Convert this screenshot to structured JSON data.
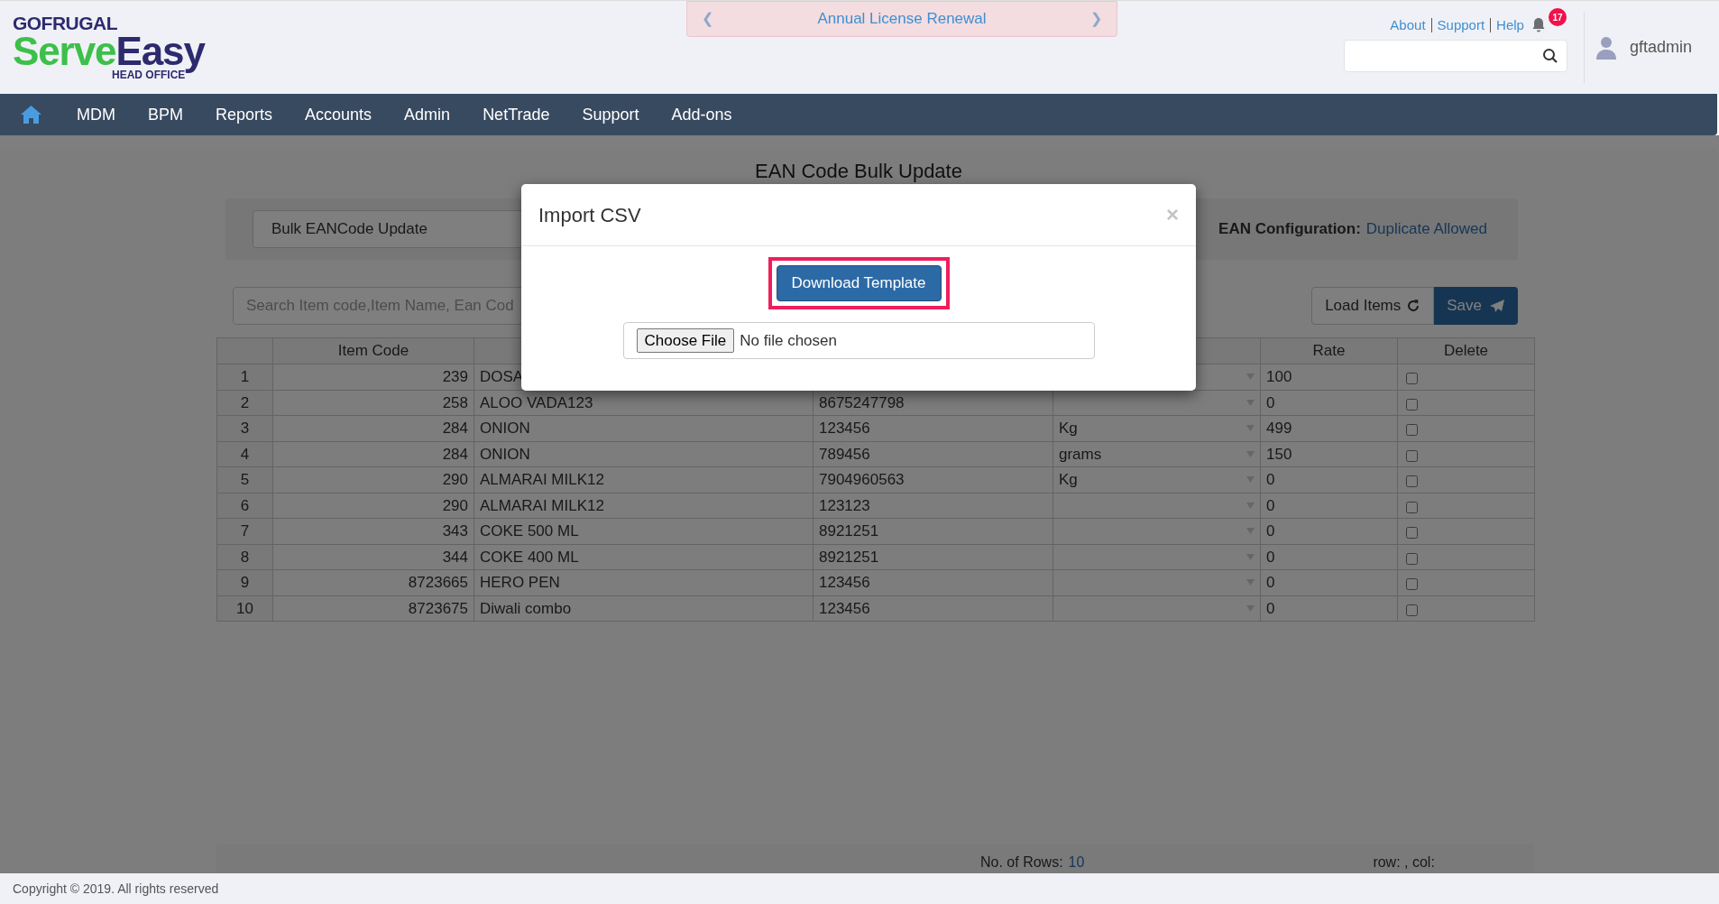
{
  "header": {
    "logo": {
      "brand": "GOFRUGAL",
      "product_first": "Serve",
      "product_second": "Easy",
      "tagline": "HEAD OFFICE"
    },
    "banner": {
      "text": "Annual License Renewal",
      "prev": "❮",
      "next": "❯"
    },
    "links": [
      "About",
      "Support",
      "Help"
    ],
    "notification_count": "17",
    "user": "gftadmin"
  },
  "nav": {
    "items": [
      {
        "label": "MDM"
      },
      {
        "label": "BPM"
      },
      {
        "label": "Reports"
      },
      {
        "label": "Accounts"
      },
      {
        "label": "Admin"
      },
      {
        "label": "NetTrade"
      },
      {
        "label": "Support"
      },
      {
        "label": "Add-ons"
      }
    ]
  },
  "page": {
    "title": "EAN Code Bulk Update",
    "mode_select": "Bulk EANCode Update",
    "ean_config_label": "EAN Configuration:",
    "ean_config_value": "Duplicate Allowed",
    "search_placeholder": "Search Item code,Item Name, Ean Cod",
    "load_button": "Load Items",
    "save_button": "Save"
  },
  "table": {
    "columns": [
      {},
      {
        "label": "Item Code"
      },
      {},
      {},
      {},
      {
        "label": "Rate"
      },
      {
        "label": "Delete"
      }
    ],
    "rows": [
      {
        "no": "1",
        "item_code": "239",
        "item_name": "DOSA",
        "rate": "100",
        "delete_checked": false
      },
      {
        "no": "2",
        "item_code": "258",
        "item_name": "ALOO VADA123",
        "ean_code": "8675247798",
        "rate": "0",
        "delete_checked": false
      },
      {
        "no": "3",
        "item_code": "284",
        "item_name": "ONION",
        "ean_code": "123456",
        "unit": "Kg",
        "rate": "499",
        "delete_checked": false
      },
      {
        "no": "4",
        "item_code": "284",
        "item_name": "ONION",
        "ean_code": "789456",
        "unit": "grams",
        "rate": "150",
        "delete_checked": false
      },
      {
        "no": "5",
        "item_code": "290",
        "item_name": "ALMARAI MILK12",
        "ean_code": "7904960563",
        "unit": "Kg",
        "rate": "0",
        "delete_checked": false
      },
      {
        "no": "6",
        "item_code": "290",
        "item_name": "ALMARAI MILK12",
        "ean_code": "123123",
        "rate": "0",
        "delete_checked": false
      },
      {
        "no": "7",
        "item_code": "343",
        "item_name": "COKE 500 ML",
        "ean_code": "8921251",
        "rate": "0",
        "delete_checked": false
      },
      {
        "no": "8",
        "item_code": "344",
        "item_name": "COKE 400 ML",
        "ean_code": "8921251",
        "rate": "0",
        "delete_checked": false
      },
      {
        "no": "9",
        "item_code": "8723665",
        "item_name": "HERO PEN",
        "ean_code": "123456",
        "rate": "0",
        "delete_checked": false
      },
      {
        "no": "10",
        "item_code": "8723675",
        "item_name": "Diwali combo",
        "ean_code": "123456",
        "rate": "0",
        "delete_checked": false
      }
    ]
  },
  "table_footer": {
    "rows_label": "No. of Rows:",
    "rows_value": "10",
    "position": "row: , col:"
  },
  "modal": {
    "title": "Import CSV",
    "close": "×",
    "download_button": "Download Template",
    "download_highlighted": true,
    "file_button": "Choose File",
    "file_status": "No file chosen"
  },
  "footer": {
    "copyright": "Copyright © 2019. All rights reserved"
  }
}
